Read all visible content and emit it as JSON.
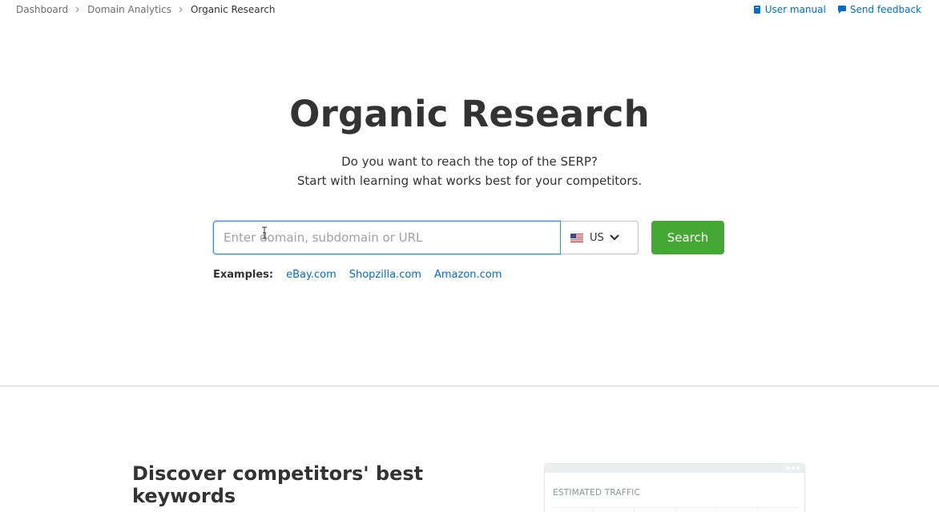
{
  "breadcrumb": {
    "items": [
      {
        "label": "Dashboard"
      },
      {
        "label": "Domain Analytics"
      },
      {
        "label": "Organic Research"
      }
    ]
  },
  "top_links": {
    "user_manual": "User manual",
    "send_feedback": "Send feedback"
  },
  "hero": {
    "title": "Organic Research",
    "subtitle_line1": "Do you want to reach the top of the SERP?",
    "subtitle_line2": "Start with learning what works best for your competitors."
  },
  "search": {
    "placeholder": "Enter domain, subdomain or URL",
    "value": "",
    "database": "US",
    "button_label": "Search"
  },
  "examples": {
    "label": "Examples:",
    "links": [
      "eBay.com",
      "Shopzilla.com",
      "Amazon.com"
    ]
  },
  "feature": {
    "heading": "Discover competitors' best keywords",
    "card_label": "ESTIMATED TRAFFIC"
  },
  "colors": {
    "link": "#006dca",
    "accent_green": "#46a834",
    "focus_blue": "#2b94e1"
  }
}
